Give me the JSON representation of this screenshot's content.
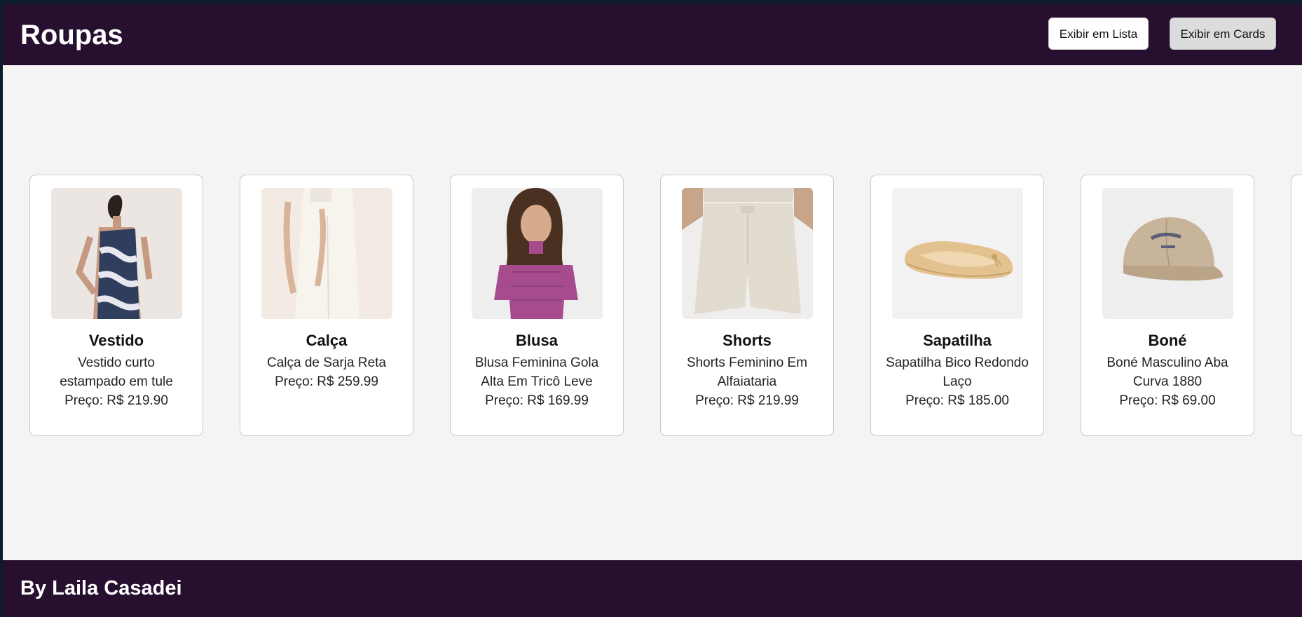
{
  "header": {
    "title": "Roupas",
    "buttons": {
      "list": "Exibir em Lista",
      "cards": "Exibir em Cards"
    }
  },
  "products": [
    {
      "name": "Vestido",
      "description": "Vestido curto estampado em tule",
      "price": "Preço: R$ 219.90",
      "image": "dress-photo"
    },
    {
      "name": "Calça",
      "description": "Calça de Sarja Reta",
      "price": "Preço: R$ 259.99",
      "image": "pants-photo"
    },
    {
      "name": "Blusa",
      "description": "Blusa Feminina Gola Alta Em Tricô Leve",
      "price": "Preço: R$ 169.99",
      "image": "blouse-photo"
    },
    {
      "name": "Shorts",
      "description": "Shorts Feminino Em Alfaiataria",
      "price": "Preço: R$ 219.99",
      "image": "shorts-photo"
    },
    {
      "name": "Sapatilha",
      "description": "Sapatilha Bico Redondo Laço",
      "price": "Preço: R$ 185.00",
      "image": "flat-shoe-photo"
    },
    {
      "name": "Boné",
      "description": "Boné Masculino Aba Curva 1880",
      "price": "Preço: R$ 69.00",
      "image": "cap-photo"
    }
  ],
  "footer": {
    "credit": "By Laila Casadei"
  },
  "colors": {
    "header_bg": "#270f2f",
    "page_bg": "#f4f4f4",
    "card_bg": "#ffffff"
  }
}
